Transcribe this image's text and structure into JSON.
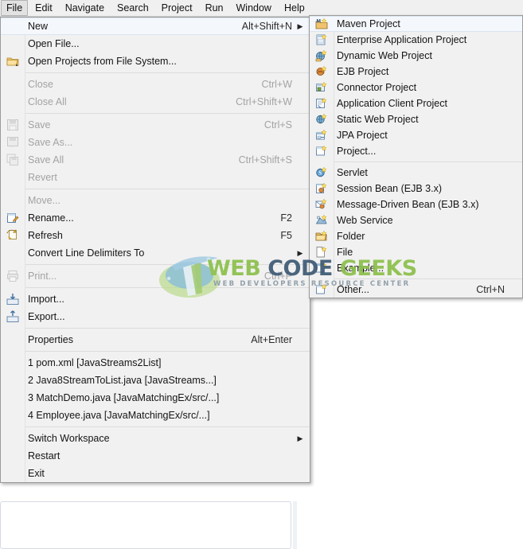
{
  "menubar": {
    "items": [
      {
        "label": "File",
        "active": true
      },
      {
        "label": "Edit",
        "active": false
      },
      {
        "label": "Navigate",
        "active": false
      },
      {
        "label": "Search",
        "active": false
      },
      {
        "label": "Project",
        "active": false
      },
      {
        "label": "Run",
        "active": false
      },
      {
        "label": "Window",
        "active": false
      },
      {
        "label": "Help",
        "active": false
      }
    ]
  },
  "file_menu": {
    "items": [
      {
        "label": "New",
        "accel": "Alt+Shift+N",
        "submenu": true,
        "highlight": true,
        "icon": "none",
        "disabled": false
      },
      {
        "separator": false,
        "label": "Open File...",
        "accel": "",
        "submenu": false,
        "icon": "none",
        "disabled": false
      },
      {
        "label": "Open Projects from File System...",
        "accel": "",
        "submenu": false,
        "icon": "open-folder-icon",
        "disabled": false
      },
      {
        "separator": true
      },
      {
        "label": "Close",
        "accel": "Ctrl+W",
        "submenu": false,
        "icon": "none",
        "disabled": true
      },
      {
        "label": "Close All",
        "accel": "Ctrl+Shift+W",
        "submenu": false,
        "icon": "none",
        "disabled": true
      },
      {
        "separator": true
      },
      {
        "label": "Save",
        "accel": "Ctrl+S",
        "submenu": false,
        "icon": "save-icon",
        "disabled": true
      },
      {
        "label": "Save As...",
        "accel": "",
        "submenu": false,
        "icon": "save-as-icon",
        "disabled": true
      },
      {
        "label": "Save All",
        "accel": "Ctrl+Shift+S",
        "submenu": false,
        "icon": "save-all-icon",
        "disabled": true
      },
      {
        "label": "Revert",
        "accel": "",
        "submenu": false,
        "icon": "none",
        "disabled": true
      },
      {
        "separator": true
      },
      {
        "label": "Move...",
        "accel": "",
        "submenu": false,
        "icon": "none",
        "disabled": true
      },
      {
        "label": "Rename...",
        "accel": "F2",
        "submenu": false,
        "icon": "rename-icon",
        "disabled": false
      },
      {
        "label": "Refresh",
        "accel": "F5",
        "submenu": false,
        "icon": "refresh-icon",
        "disabled": false
      },
      {
        "label": "Convert Line Delimiters To",
        "accel": "",
        "submenu": true,
        "icon": "none",
        "disabled": false
      },
      {
        "separator": true
      },
      {
        "label": "Print...",
        "accel": "Ctrl+P",
        "submenu": false,
        "icon": "print-icon",
        "disabled": true
      },
      {
        "separator": true
      },
      {
        "label": "Import...",
        "accel": "",
        "submenu": false,
        "icon": "import-icon",
        "disabled": false
      },
      {
        "label": "Export...",
        "accel": "",
        "submenu": false,
        "icon": "export-icon",
        "disabled": false
      },
      {
        "separator": true
      },
      {
        "label": "Properties",
        "accel": "Alt+Enter",
        "submenu": false,
        "icon": "none",
        "disabled": false
      },
      {
        "separator": true
      },
      {
        "label": "1 pom.xml  [JavaStreams2List]",
        "accel": "",
        "submenu": false,
        "icon": "none",
        "disabled": false
      },
      {
        "label": "2 Java8StreamToList.java  [JavaStreams...]",
        "accel": "",
        "submenu": false,
        "icon": "none",
        "disabled": false
      },
      {
        "label": "3 MatchDemo.java  [JavaMatchingEx/src/...]",
        "accel": "",
        "submenu": false,
        "icon": "none",
        "disabled": false
      },
      {
        "label": "4 Employee.java  [JavaMatchingEx/src/...]",
        "accel": "",
        "submenu": false,
        "icon": "none",
        "disabled": false
      },
      {
        "separator": true
      },
      {
        "label": "Switch Workspace",
        "accel": "",
        "submenu": true,
        "icon": "none",
        "disabled": false
      },
      {
        "label": "Restart",
        "accel": "",
        "submenu": false,
        "icon": "none",
        "disabled": false
      },
      {
        "label": "Exit",
        "accel": "",
        "submenu": false,
        "icon": "none",
        "disabled": false
      }
    ]
  },
  "new_submenu": {
    "items": [
      {
        "label": "Maven Project",
        "accel": "",
        "icon": "maven-project-icon",
        "highlight": true
      },
      {
        "label": "Enterprise Application Project",
        "accel": "",
        "icon": "enterprise-application-project-icon"
      },
      {
        "label": "Dynamic Web Project",
        "accel": "",
        "icon": "dynamic-web-project-icon"
      },
      {
        "label": "EJB Project",
        "accel": "",
        "icon": "ejb-project-icon"
      },
      {
        "label": "Connector Project",
        "accel": "",
        "icon": "connector-project-icon"
      },
      {
        "label": "Application Client Project",
        "accel": "",
        "icon": "application-client-project-icon"
      },
      {
        "label": "Static Web Project",
        "accel": "",
        "icon": "static-web-project-icon"
      },
      {
        "label": "JPA Project",
        "accel": "",
        "icon": "jpa-project-icon"
      },
      {
        "label": "Project...",
        "accel": "",
        "icon": "project-icon"
      },
      {
        "separator": true
      },
      {
        "label": "Servlet",
        "accel": "",
        "icon": "servlet-icon"
      },
      {
        "label": "Session Bean (EJB 3.x)",
        "accel": "",
        "icon": "session-bean-icon"
      },
      {
        "label": "Message-Driven Bean (EJB 3.x)",
        "accel": "",
        "icon": "message-driven-bean-icon"
      },
      {
        "label": "Web Service",
        "accel": "",
        "icon": "web-service-icon"
      },
      {
        "label": "Folder",
        "accel": "",
        "icon": "folder-icon"
      },
      {
        "label": "File",
        "accel": "",
        "icon": "file-icon"
      },
      {
        "label": "Example...",
        "accel": "",
        "icon": "example-icon"
      },
      {
        "separator": true
      },
      {
        "label": "Other...",
        "accel": "Ctrl+N",
        "icon": "other-icon"
      }
    ]
  },
  "watermark": {
    "word1": "WEB",
    "word2": "CODE",
    "word3": "GEEKS",
    "subtitle": "WEB DEVELOPERS RESOURCE CENTER",
    "color_green": "#8cc04a",
    "color_blue": "#3e5a74"
  }
}
